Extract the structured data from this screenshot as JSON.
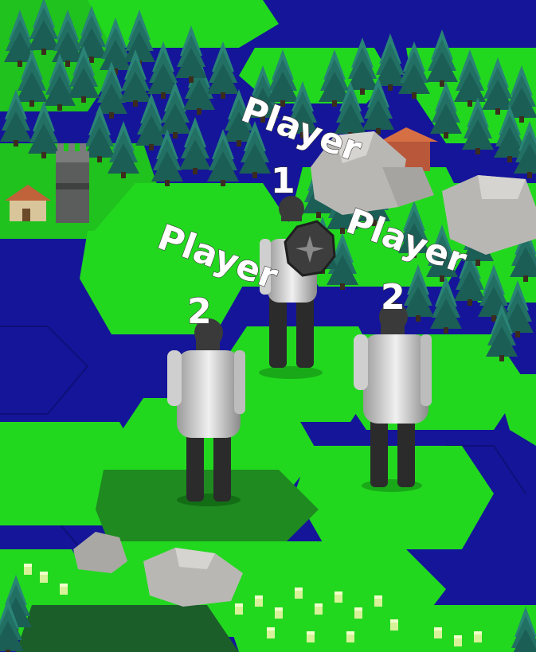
{
  "units": [
    {
      "label_line1": "Player",
      "label_line2": "1"
    },
    {
      "label_line1": "Player",
      "label_line2": "2"
    },
    {
      "label_line1": "Player",
      "label_line2": "2"
    }
  ],
  "colors": {
    "water": "#15159a",
    "grass": "#21d61f",
    "grass_dark": "#1c9a1e",
    "forest": "#1f6b63",
    "rock": "#b8b6b2",
    "unit_body": "#d7d7d7",
    "unit_dark": "#2a2a2a"
  }
}
